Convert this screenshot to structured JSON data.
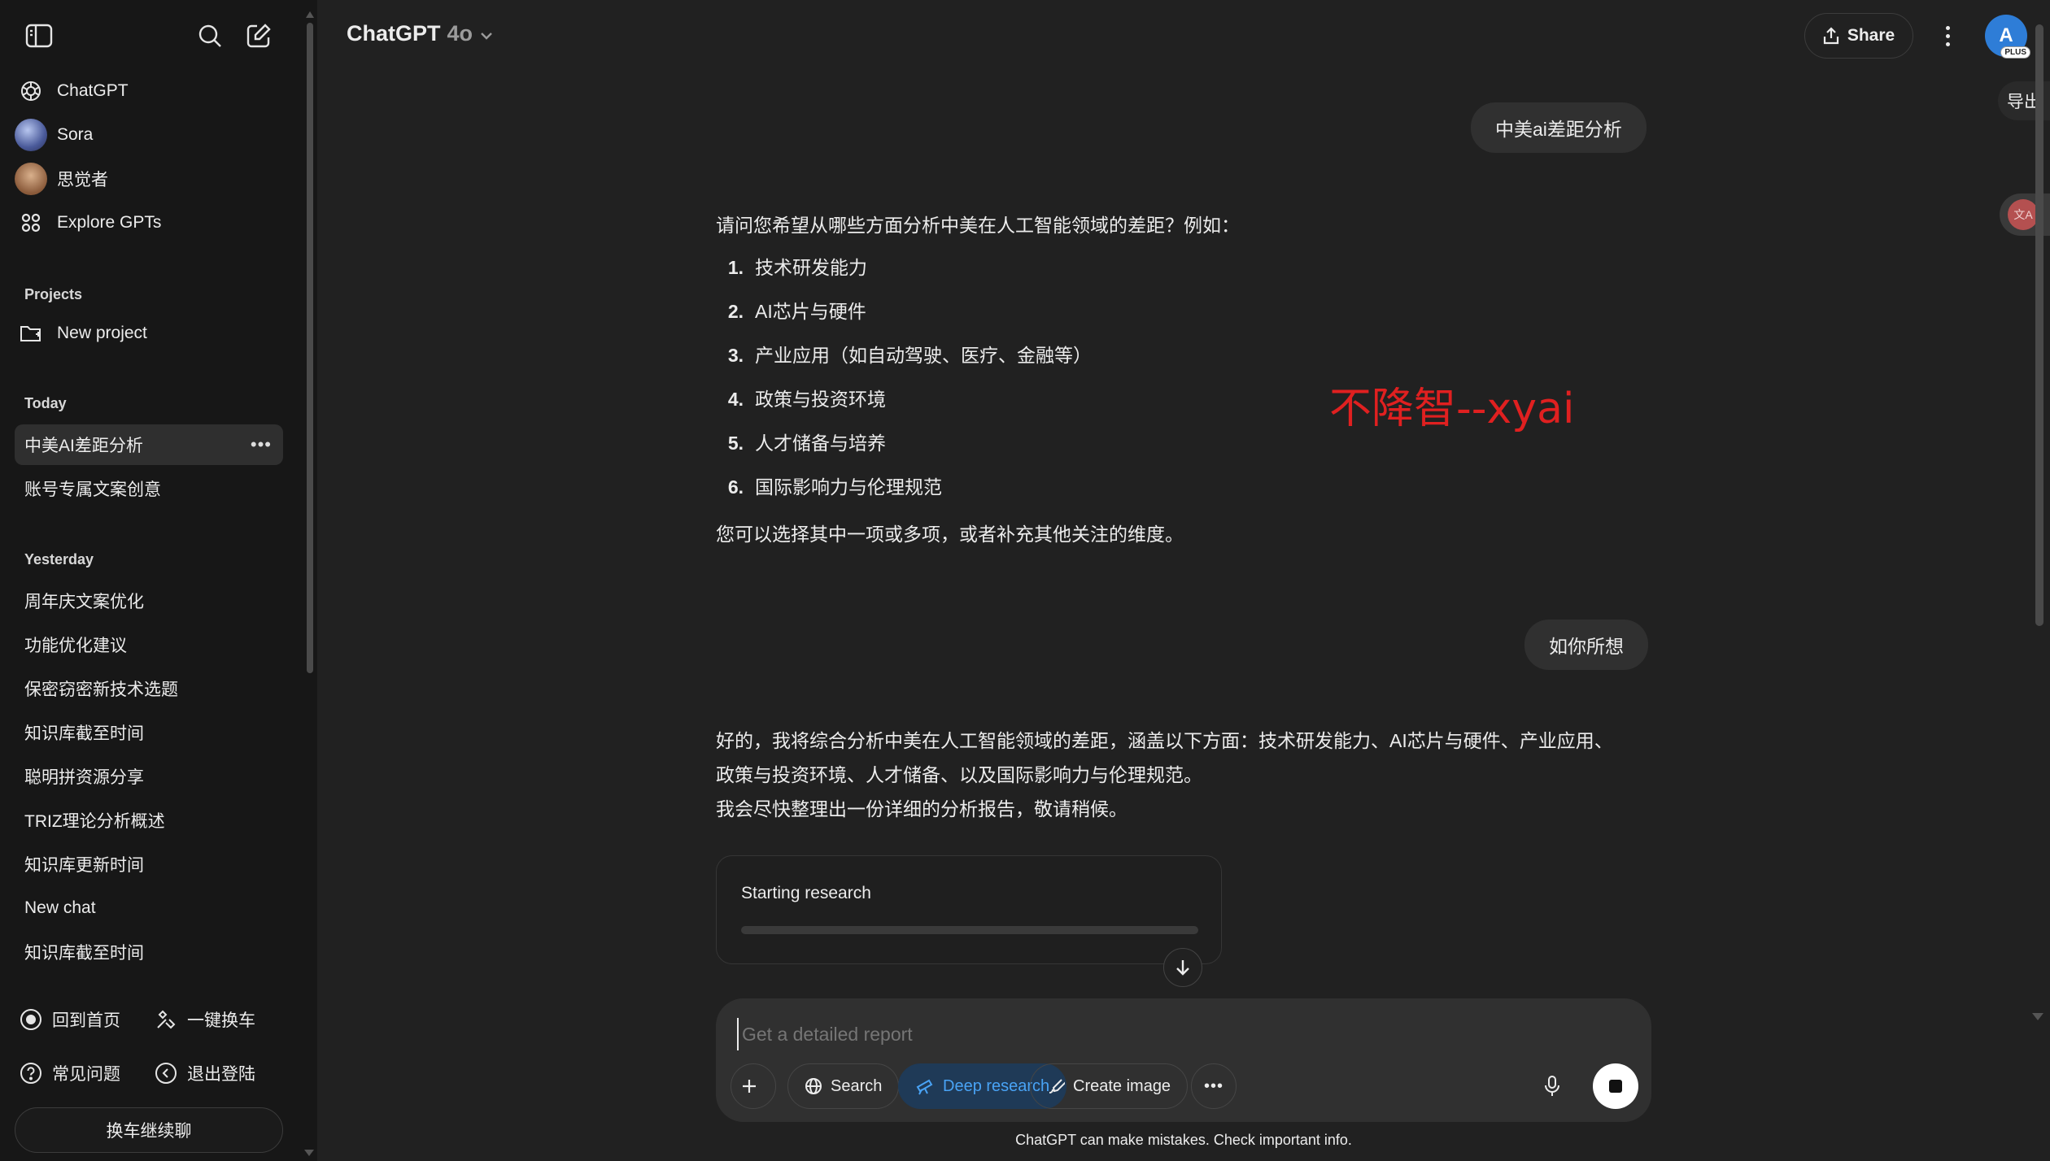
{
  "sidebar": {
    "nav": [
      {
        "label": "ChatGPT",
        "icon": "openai-logo-icon"
      },
      {
        "label": "Sora",
        "icon": "sora-avatar-icon"
      },
      {
        "label": "思觉者",
        "icon": "gpt-avatar-icon"
      },
      {
        "label": "Explore GPTs",
        "icon": "grid-icon"
      }
    ],
    "projects_label": "Projects",
    "new_project_label": "New project",
    "today_label": "Today",
    "today_chats": [
      "中美AI差距分析",
      "账号专属文案创意"
    ],
    "yesterday_label": "Yesterday",
    "yesterday_chats": [
      "周年庆文案优化",
      "功能优化建议",
      "保密窃密新技术选题",
      "知识库截至时间",
      "聪明拼资源分享",
      "TRIZ理论分析概述",
      "知识库更新时间",
      "New chat",
      "知识库截至时间"
    ],
    "actions": {
      "home": "回到首页",
      "switch_car": "一键换车",
      "faq": "常见问题",
      "logout": "退出登陆",
      "continue_button": "换车继续聊"
    }
  },
  "header": {
    "model_name": "ChatGPT",
    "model_version": "4o",
    "share_label": "Share",
    "avatar_initial": "A",
    "plan_badge": "PLUS"
  },
  "side_tabs": {
    "export_label": "导出",
    "translate_label": "文A"
  },
  "conversation": {
    "user_1": "中美ai差距分析",
    "assistant_1": {
      "intro": "请问您希望从哪些方面分析中美在人工智能领域的差距？例如：",
      "items": [
        {
          "num": "1.",
          "text": "技术研发能力"
        },
        {
          "num": "2.",
          "text": "AI芯片与硬件"
        },
        {
          "num": "3.",
          "text": "产业应用（如自动驾驶、医疗、金融等）"
        },
        {
          "num": "4.",
          "text": "政策与投资环境"
        },
        {
          "num": "5.",
          "text": "人才储备与培养"
        },
        {
          "num": "6.",
          "text": "国际影响力与伦理规范"
        }
      ],
      "outro": "您可以选择其中一项或多项，或者补充其他关注的维度。"
    },
    "watermark": "不降智--xyai",
    "user_2": "如你所想",
    "assistant_2": {
      "line1": "好的，我将综合分析中美在人工智能领域的差距，涵盖以下方面：技术研发能力、AI芯片与硬件、产业应用、",
      "line2": "政策与投资环境、人才储备、以及国际影响力与伦理规范。",
      "line3": "我会尽快整理出一份详细的分析报告，敬请稍候。"
    },
    "research_card": {
      "title": "Starting research",
      "progress": 0.0
    }
  },
  "composer": {
    "placeholder": "Get a detailed report",
    "search_label": "Search",
    "deep_research_label": "Deep research",
    "create_image_label": "Create image"
  },
  "footer": {
    "disclaimer": "ChatGPT can make mistakes. Check important info."
  },
  "colors": {
    "background": "#212121",
    "sidebar": "#171717",
    "deep_research_accent": "#49a3f5",
    "watermark": "#e02020",
    "avatar": "#2e7dd7"
  }
}
